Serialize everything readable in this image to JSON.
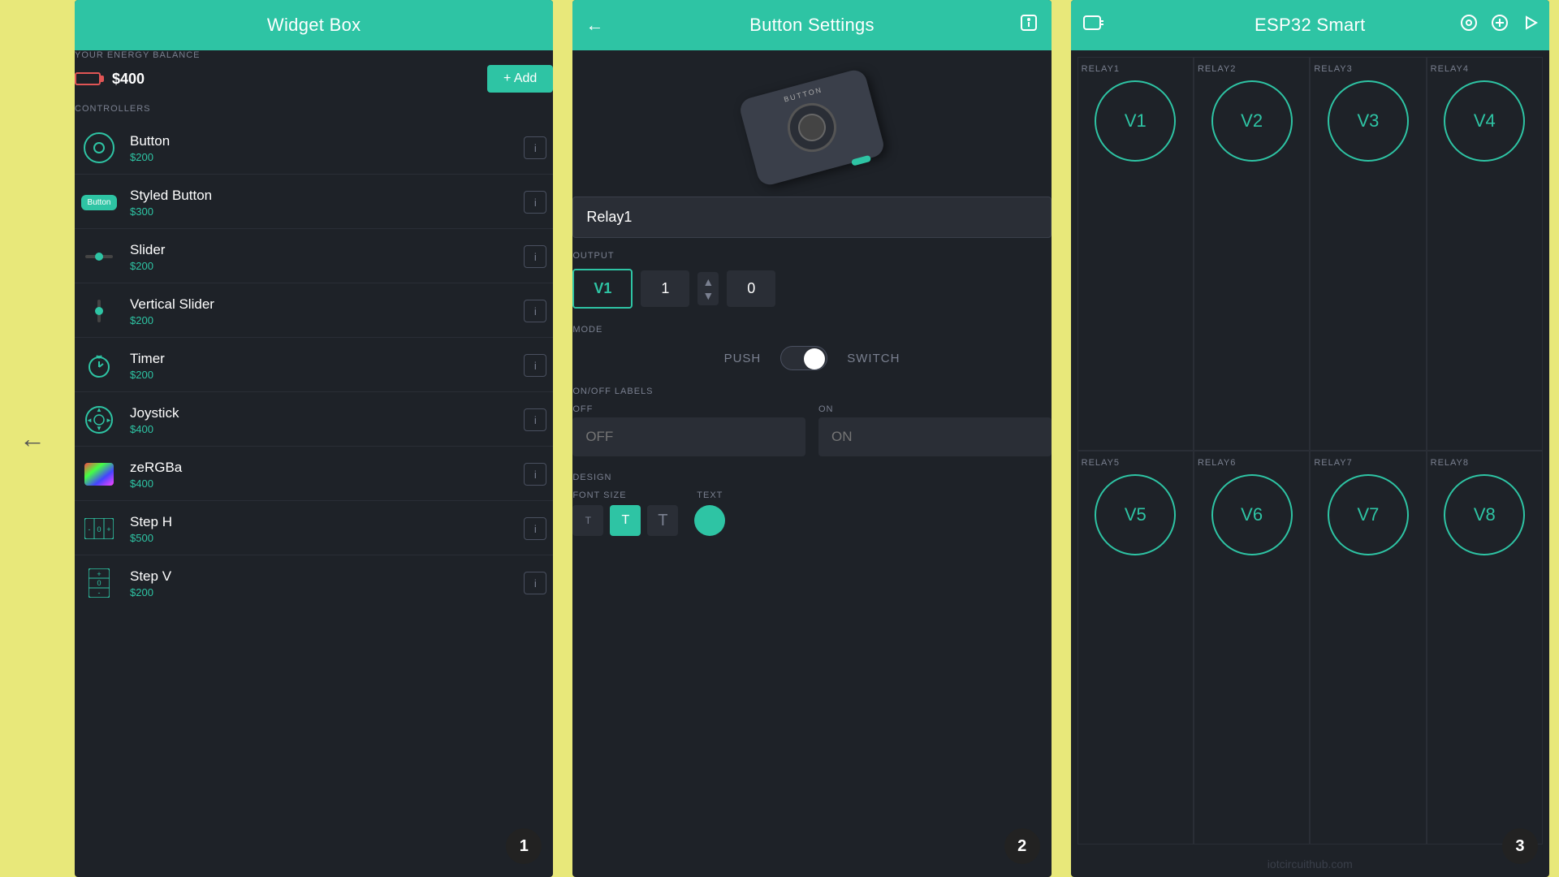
{
  "background_color": "#e8e87a",
  "left_arrow": "←",
  "panel1": {
    "title": "Widget Box",
    "energy": {
      "label": "YOUR ENERGY BALANCE",
      "value": "$400",
      "add_btn": "+ Add"
    },
    "controllers_label": "CONTROLLERS",
    "widgets": [
      {
        "name": "Button",
        "price": "$200",
        "icon_type": "circle"
      },
      {
        "name": "Styled Button",
        "price": "$300",
        "icon_type": "styled_btn"
      },
      {
        "name": "Slider",
        "price": "$200",
        "icon_type": "slider"
      },
      {
        "name": "Vertical Slider",
        "price": "$200",
        "icon_type": "vslider"
      },
      {
        "name": "Timer",
        "price": "$200",
        "icon_type": "timer"
      },
      {
        "name": "Joystick",
        "price": "$400",
        "icon_type": "joystick"
      },
      {
        "name": "zeRGBa",
        "price": "$400",
        "icon_type": "zergba"
      },
      {
        "name": "Step H",
        "price": "$500",
        "icon_type": "steph"
      },
      {
        "name": "Step V",
        "price": "$200",
        "icon_type": "stepv"
      }
    ],
    "badge": "1"
  },
  "panel2": {
    "title": "Button Settings",
    "relay_name": "Relay1",
    "output_label": "OUTPUT",
    "output_v": "V1",
    "output_num1": "1",
    "output_num2": "0",
    "mode_label": "MODE",
    "push_label": "PUSH",
    "switch_label": "SWITCH",
    "on_off_labels_label": "ON/OFF LABELS",
    "off_label": "OFF",
    "off_placeholder": "OFF",
    "on_label": "ON",
    "on_placeholder": "ON",
    "design_label": "DESIGN",
    "font_size_label": "FONT SIZE",
    "font_sizes": [
      "T",
      "T",
      "T"
    ],
    "font_size_active": 1,
    "text_label": "TEXT",
    "badge": "2"
  },
  "panel3": {
    "title": "ESP32 Smart",
    "relays_row1": [
      {
        "label": "RELAY1",
        "value": "V1"
      },
      {
        "label": "RELAY2",
        "value": "V2"
      },
      {
        "label": "RELAY3",
        "value": "V3"
      },
      {
        "label": "RELAY4",
        "value": "V4"
      }
    ],
    "relays_row2": [
      {
        "label": "RELAY5",
        "value": "V5"
      },
      {
        "label": "RELAY6",
        "value": "V6"
      },
      {
        "label": "RELAY7",
        "value": "V7"
      },
      {
        "label": "RELAY8",
        "value": "V8"
      }
    ],
    "watermark": "iotcircuithub.com",
    "badge": "3"
  }
}
